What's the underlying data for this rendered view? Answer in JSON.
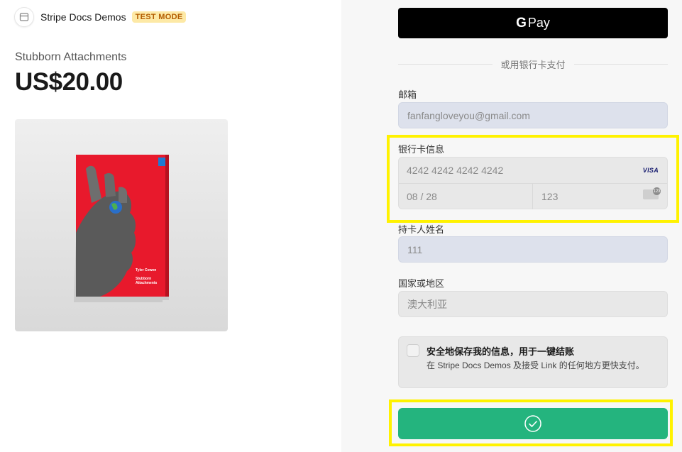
{
  "merchant": {
    "name": "Stripe Docs Demos",
    "badge": "TEST MODE",
    "logo_icon": "store-icon"
  },
  "product": {
    "name": "Stubborn Attachments",
    "price": "US$20.00",
    "cover": {
      "author": "Tyler Cowen",
      "title_line1": "Stubborn",
      "title_line2": "Attachments",
      "color": "#e8192c"
    }
  },
  "payment": {
    "gpay_g": "G",
    "gpay_label": "Pay",
    "divider_text": "或用银行卡支付",
    "email": {
      "label": "邮箱",
      "value": "fanfangloveyou@gmail.com"
    },
    "card": {
      "label": "银行卡信息",
      "number_placeholder": "4242 4242 4242 4242",
      "brand": "VISA",
      "expiry_placeholder": "08 / 28",
      "cvc_placeholder": "123",
      "cvc_badge": "123"
    },
    "cardholder": {
      "label": "持卡人姓名",
      "value": "111"
    },
    "country": {
      "label": "国家或地区",
      "value": "澳大利亚"
    },
    "save_info": {
      "title": "安全地保存我的信息，用于一键结账",
      "description": "在 Stripe Docs Demos 及接受 Link 的任何地方更快支付。"
    },
    "pay_button_icon": "check-circle-icon"
  },
  "colors": {
    "highlight": "#fff200",
    "pay_button": "#24b47e",
    "test_badge_bg": "#fde9a6"
  }
}
